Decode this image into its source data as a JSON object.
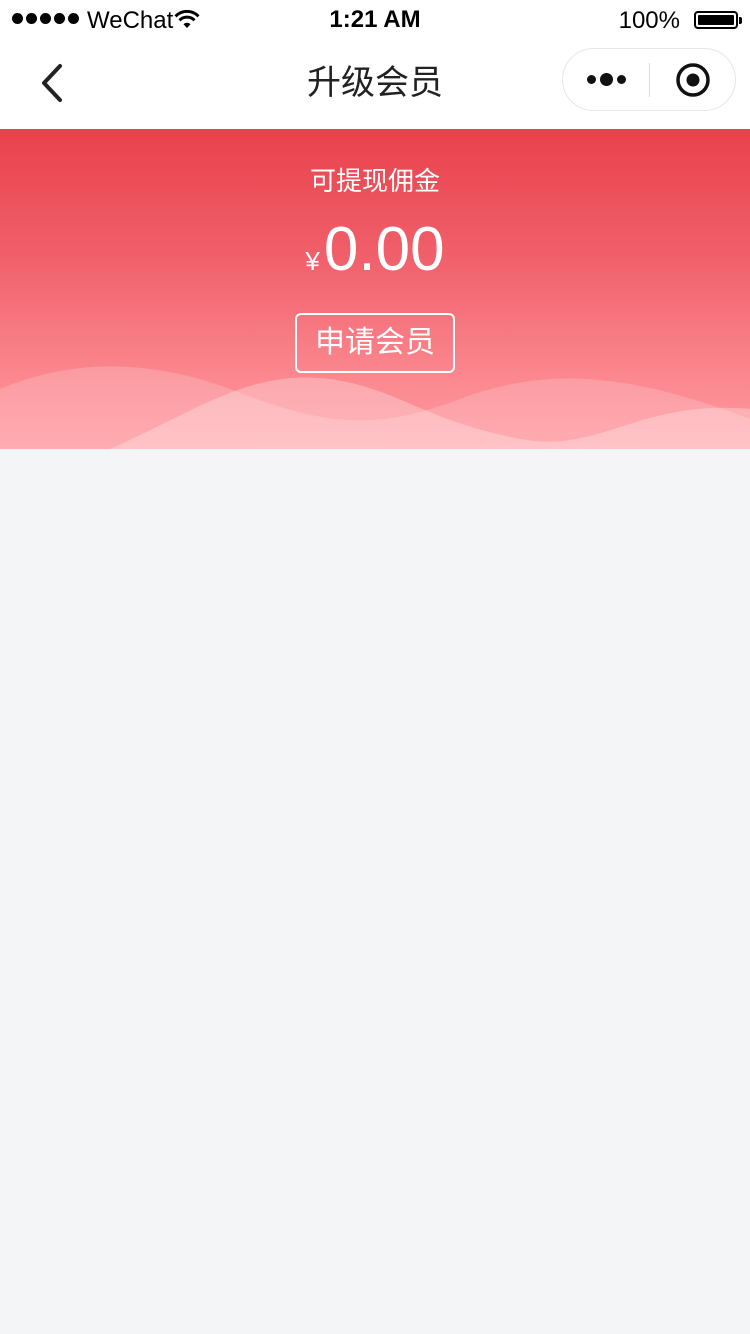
{
  "status_bar": {
    "carrier": "WeChat",
    "time": "1:21 AM",
    "battery_percent": "100%",
    "battery_level": 1.0
  },
  "nav": {
    "title": "升级会员",
    "back_icon": "chevron-left-icon",
    "more_icon": "more-dots-icon",
    "close_icon": "target-close-icon"
  },
  "header": {
    "commission_label": "可提现佣金",
    "currency_symbol": "¥",
    "amount": "0.00",
    "apply_button_label": "申请会员",
    "gradient_top": "#e9414c",
    "gradient_bottom": "#ff9aa0"
  }
}
